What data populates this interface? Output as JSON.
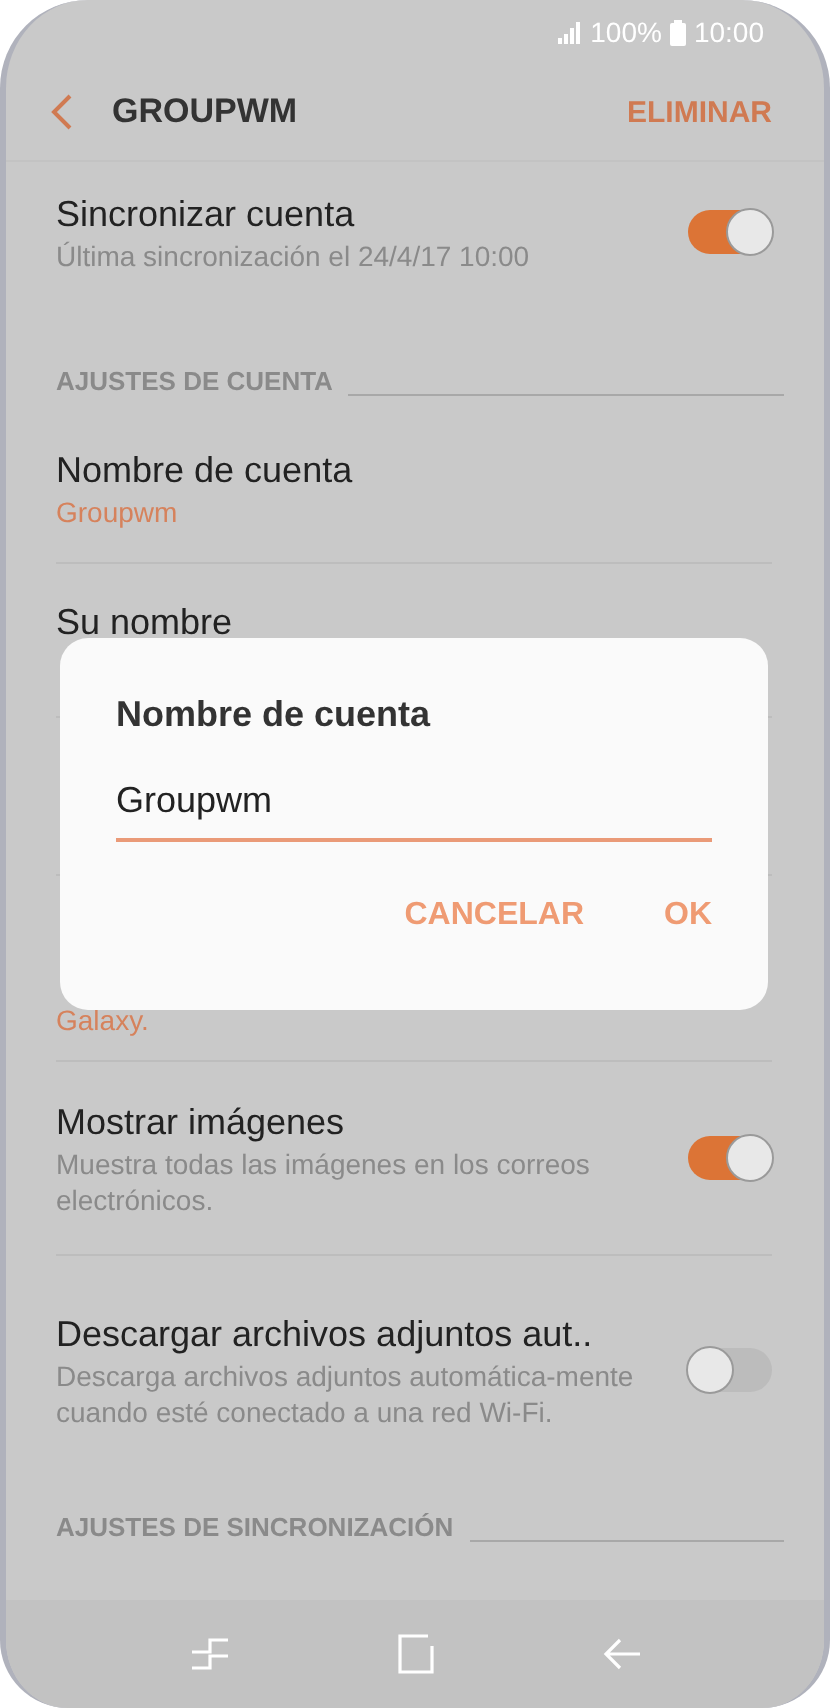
{
  "status_bar": {
    "battery": "100%",
    "time": "10:00"
  },
  "header": {
    "title": "GROUPWM",
    "action": "ELIMINAR"
  },
  "items": [
    {
      "kind": "toggle",
      "title": "Sincronizar cuenta",
      "subtitle": "Última sincronización el 24/4/17  10:00",
      "on": true
    },
    {
      "kind": "section",
      "title": "AJUSTES DE CUENTA"
    },
    {
      "kind": "value",
      "title": "Nombre de cuenta",
      "subtitle": "Groupwm"
    },
    {
      "kind": "value",
      "title": "Su nombre"
    },
    {
      "kind": "value"
    },
    {
      "kind": "value",
      "subtitle_more": "Galaxy."
    },
    {
      "kind": "toggle",
      "title": "Mostrar imágenes",
      "subtitle": "Muestra todas las imágenes en los correos electrónicos.",
      "on": true
    },
    {
      "kind": "toggle",
      "title": "Descargar archivos adjuntos aut..",
      "subtitle": "Descarga archivos adjuntos automática-mente cuando esté conectado a una red Wi-Fi.",
      "on": false
    },
    {
      "kind": "section",
      "title": "AJUSTES DE SINCRONIZACIÓN"
    }
  ],
  "dialog": {
    "title": "Nombre de cuenta",
    "value": "Groupwm",
    "buttons": [
      "CANCELAR",
      "OK"
    ]
  }
}
